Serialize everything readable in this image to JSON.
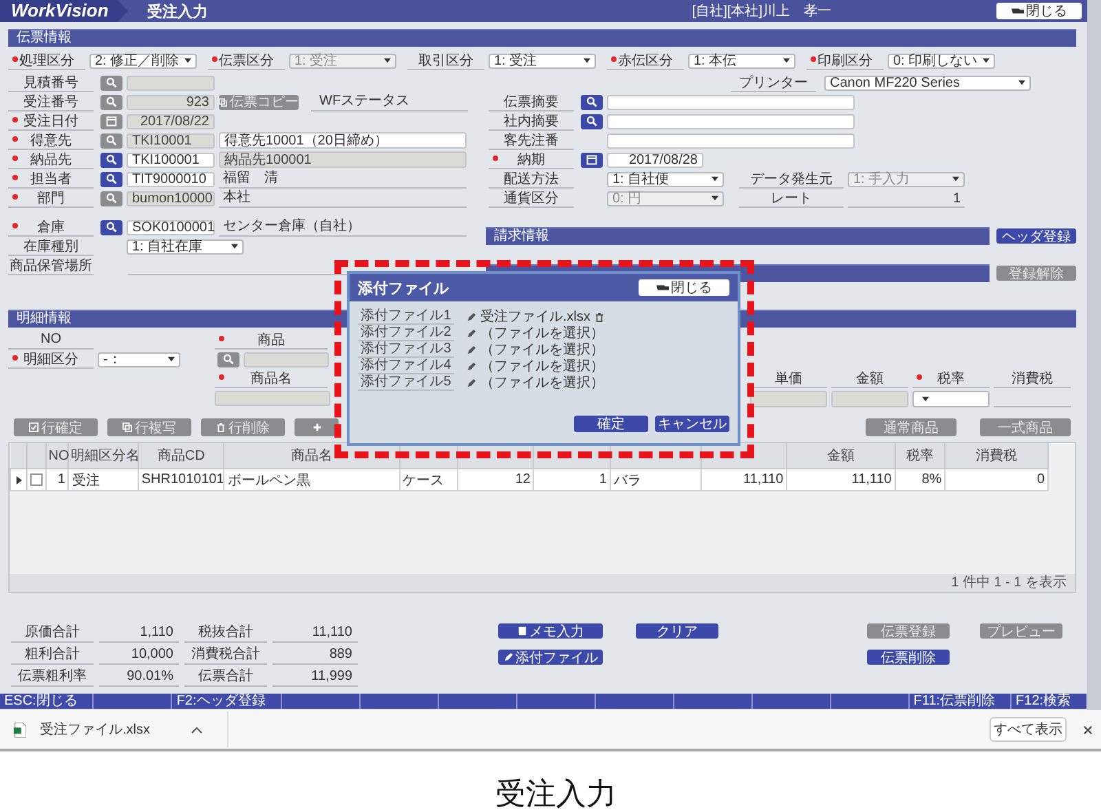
{
  "app": {
    "logo": "WorkVision",
    "screen_title": "受注入力",
    "user": "[自社][本社]川上　孝一",
    "close_button": "閉じる"
  },
  "slip": {
    "title": "伝票情報",
    "selects": [
      {
        "label": "処理区分",
        "required": true,
        "value": "2: 修正／削除",
        "disabled": false
      },
      {
        "label": "伝票区分",
        "required": true,
        "value": "1: 受注",
        "disabled": true
      },
      {
        "label": "取引区分",
        "required": false,
        "value": "1: 受注",
        "disabled": false
      },
      {
        "label": "赤伝区分",
        "required": true,
        "value": "1: 本伝",
        "disabled": false
      },
      {
        "label": "印刷区分",
        "required": true,
        "value": "0: 印刷しない",
        "disabled": false
      }
    ],
    "printer": {
      "label": "プリンター",
      "value": "Canon MF220 Series"
    },
    "left_rows": [
      {
        "label": "見積番号",
        "required": false,
        "lookup": {
          "kind": "search",
          "enabled": false
        },
        "code": {
          "readonly": true
        }
      },
      {
        "label": "受注番号",
        "required": false,
        "lookup": {
          "kind": "search",
          "enabled": false
        },
        "code": {
          "value": "923",
          "readonly": true,
          "right_aligned": true
        },
        "copy_button": {
          "label": "伝票コピー",
          "disabled": true
        },
        "side_label": "WFステータス"
      },
      {
        "label": "受注日付",
        "required": true,
        "lookup": {
          "kind": "calendar",
          "enabled": false
        },
        "code": {
          "value": "2017/08/22",
          "readonly": true,
          "right_aligned": true
        }
      },
      {
        "label": "得意先",
        "required": true,
        "lookup": {
          "kind": "search",
          "enabled": false
        },
        "code": {
          "value": "TKI10001",
          "readonly": true
        },
        "name": {
          "value": "得意先10001（20日締め）",
          "kind": "input"
        }
      },
      {
        "label": "納品先",
        "required": true,
        "lookup": {
          "kind": "search",
          "enabled": true
        },
        "code": {
          "value": "TKI100001",
          "readonly": false
        },
        "name": {
          "value": "納品先100001",
          "kind": "readonly"
        }
      },
      {
        "label": "担当者",
        "required": true,
        "lookup": {
          "kind": "search",
          "enabled": true
        },
        "code": {
          "value": "TIT9000010",
          "readonly": false
        },
        "name": {
          "value": "福留　清",
          "kind": "text"
        }
      },
      {
        "label": "部門",
        "required": true,
        "lookup": {
          "kind": "search",
          "enabled": false
        },
        "code": {
          "value": "bumon10000",
          "readonly": true
        },
        "name": {
          "value": "本社",
          "kind": "text"
        }
      },
      {
        "label": "倉庫",
        "required": true,
        "spaced": true,
        "lookup": {
          "kind": "search",
          "enabled": true
        },
        "code": {
          "value": "SOK0100001",
          "readonly": false
        },
        "name": {
          "value": "センター倉庫（自社）",
          "kind": "text"
        }
      },
      {
        "label": "在庫種別",
        "required": false,
        "select": {
          "value": "1: 自社在庫",
          "disabled": false
        }
      },
      {
        "label": "商品保管場所",
        "required": false,
        "blank_lines": true
      }
    ],
    "middle_rows": [
      {
        "label": "伝票摘要",
        "required": false,
        "lookup": {
          "kind": "search",
          "enabled": true
        },
        "field": {
          "kind": "wide"
        }
      },
      {
        "label": "社内摘要",
        "required": false,
        "lookup": {
          "kind": "search",
          "enabled": true
        },
        "field": {
          "kind": "wide"
        }
      },
      {
        "label": "客先注番",
        "required": false,
        "field": {
          "kind": "wide"
        }
      },
      {
        "label": "納期",
        "required": true,
        "lookup": {
          "kind": "calendar",
          "enabled": true
        },
        "field": {
          "kind": "date",
          "value": "2017/08/28"
        }
      },
      {
        "label": "配送方法",
        "required": false,
        "select": {
          "value": "1: 自社便",
          "disabled": false
        },
        "sub": {
          "label": "データ発生元",
          "select": {
            "value": "1: 手入力",
            "disabled": true
          }
        }
      },
      {
        "label": "通貨区分",
        "required": false,
        "select": {
          "value": "0: 円",
          "disabled": true
        },
        "sub": {
          "label": "レート",
          "value": "1"
        }
      }
    ],
    "bars": [
      {
        "title": "請求情報",
        "button": {
          "label": "ヘッダ登録",
          "disabled": false
        }
      },
      {
        "button": {
          "label": "登録解除",
          "disabled": true
        }
      }
    ]
  },
  "detail": {
    "title": "明細情報",
    "no_label": "NO",
    "kind_field": {
      "label": "明細区分",
      "required": true,
      "value": "-：",
      "disabled": false
    },
    "product": {
      "label": "商品",
      "required": true
    },
    "product_name": {
      "label": "商品名",
      "required": true
    },
    "amount_fields": [
      {
        "label": "単価",
        "required": false,
        "kind": "readonly"
      },
      {
        "label": "金額",
        "required": false,
        "kind": "readonly"
      },
      {
        "label": "税率",
        "required": true,
        "kind": "select"
      },
      {
        "label": "消費税",
        "required": false,
        "kind": "text"
      }
    ],
    "row_buttons": [
      {
        "label": "行確定",
        "disabled": true
      },
      {
        "label": "行複写",
        "disabled": true
      },
      {
        "label": "行削除",
        "disabled": true
      },
      {
        "disabled": true
      }
    ],
    "product_buttons": [
      {
        "label": "通常商品",
        "disabled": true
      },
      {
        "label": "一式商品",
        "disabled": true
      }
    ],
    "table": {
      "columns": [
        {
          "kind": "header",
          "label": "NO"
        },
        {
          "kind": "header",
          "label": "明細区分名"
        },
        {
          "kind": "header",
          "label": "商品CD"
        },
        {
          "kind": "header",
          "label": "商品名"
        },
        {
          "kind": "covered"
        },
        {
          "kind": "covered"
        },
        {
          "kind": "covered"
        },
        {
          "kind": "covered"
        },
        {
          "kind": "covered"
        },
        {
          "kind": "header",
          "label": "金額"
        },
        {
          "kind": "header",
          "label": "税率"
        },
        {
          "kind": "header",
          "label": "消費税"
        }
      ],
      "rows": [
        {
          "selected": false,
          "checked": false,
          "cells": [
            "1",
            "受注",
            "SHR1010101",
            "ボールペン黒",
            "ケース",
            "12",
            "1",
            "バラ",
            "11,110",
            "11,110",
            "8%",
            "0"
          ]
        }
      ],
      "footer": "1 件中 1 - 1 を表示"
    }
  },
  "totals": [
    {
      "label": "原価合計",
      "value": "1,110"
    },
    {
      "label": "税抜合計",
      "value": "11,110"
    },
    {
      "label": "粗利合計",
      "value": "10,000"
    },
    {
      "label": "消費税合計",
      "value": "889"
    },
    {
      "label": "伝票粗利率",
      "value": "90.01%"
    },
    {
      "label": "伝票合計",
      "value": "11,999"
    }
  ],
  "actions": {
    "left": [
      {
        "label": "メモ入力",
        "disabled": false
      },
      {
        "label": "添付ファイル",
        "disabled": false
      }
    ],
    "middle": [
      {
        "label": "クリア",
        "disabled": false
      }
    ],
    "right": [
      {
        "label": "伝票登録",
        "disabled": true
      },
      {
        "label": "プレビュー",
        "disabled": true
      },
      {
        "label": "伝票削除",
        "disabled": false
      }
    ]
  },
  "function_keys": [
    {
      "kind": "key",
      "label": "ESC:閉じる"
    },
    {
      "kind": "blank"
    },
    {
      "kind": "key",
      "label": "F2:ヘッダ登録"
    },
    {
      "kind": "blank"
    },
    {
      "kind": "blank"
    },
    {
      "kind": "blank"
    },
    {
      "kind": "blank"
    },
    {
      "kind": "blank"
    },
    {
      "kind": "blank"
    },
    {
      "kind": "blank"
    },
    {
      "kind": "blank"
    },
    {
      "kind": "key",
      "label": "F11:伝票削除"
    },
    {
      "kind": "key",
      "label": "F12:検索"
    }
  ],
  "download_bar": {
    "file": "受注ファイル.xlsx",
    "show_all": "すべて表示"
  },
  "dialog": {
    "title": "添付ファイル",
    "close_button": "閉じる",
    "files": [
      {
        "label": "添付ファイル1",
        "value": "受注ファイル.xlsx",
        "attached": true
      },
      {
        "label": "添付ファイル2",
        "value": "（ファイルを選択）",
        "attached": false
      },
      {
        "label": "添付ファイル3",
        "value": "（ファイルを選択）",
        "attached": false
      },
      {
        "label": "添付ファイル4",
        "value": "（ファイルを選択）",
        "attached": false
      },
      {
        "label": "添付ファイル5",
        "value": "（ファイルを選択）",
        "attached": false
      }
    ],
    "buttons": [
      {
        "label": "確定"
      },
      {
        "label": "キャンセル"
      }
    ]
  },
  "caption": "受注入力"
}
